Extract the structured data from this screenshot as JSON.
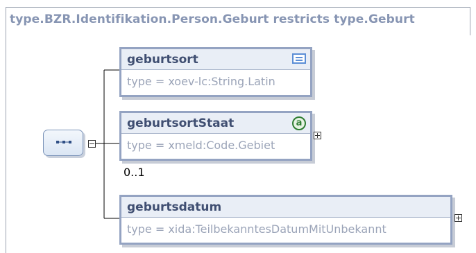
{
  "diagram": {
    "title": "type.BZR.Identifikation.Person.Geburt restricts type.Geburt",
    "compositor": {
      "icon": "sequence-icon",
      "toggle": "collapse-minus-icon"
    },
    "elements": [
      {
        "name": "geburtsort",
        "type_label": "type = xoev-lc:String.Latin",
        "badge_icon": "documentation-icon",
        "has_children": false
      },
      {
        "name": "geburtsortStaat",
        "type_label": "type = xmeld:Code.Gebiet",
        "badge_icon": "attribute-icon",
        "badge_text": "a",
        "has_children": true,
        "occurrence": "0..1"
      },
      {
        "name": "geburtsdatum",
        "type_label": "type = xida:TeilbekanntesDatumMitUnbekannt",
        "has_children": true
      }
    ],
    "colors": {
      "title": "#8795b3",
      "element_border": "#94a3c2",
      "element_name": "#404f72",
      "type_text": "#9ba4b8",
      "attribute_badge": "#2f7d32",
      "documentation_badge": "#5b8ed6"
    }
  }
}
